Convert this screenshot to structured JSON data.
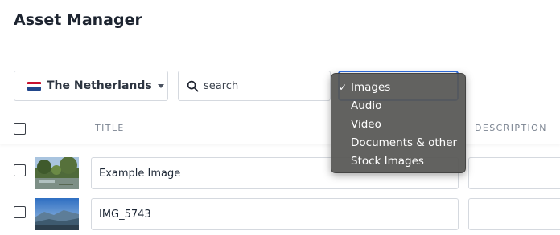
{
  "app": {
    "title": "Asset Manager"
  },
  "filters": {
    "country": {
      "label": "The Netherlands",
      "flag_colors": [
        "#c8102e",
        "#ffffff",
        "#21468b"
      ]
    },
    "search": {
      "placeholder": "search",
      "value": ""
    },
    "type_select": {
      "selected": "Images",
      "check_mark": "✓",
      "options": [
        "Images",
        "Audio",
        "Video",
        "Documents & other",
        "Stock Images"
      ]
    }
  },
  "table": {
    "columns": {
      "title": "TITLE",
      "description": "DESCRIPTION"
    },
    "rows": [
      {
        "title": "Example Image",
        "description": "",
        "thumbnail": "landscape-pond-thumbnail"
      },
      {
        "title": "IMG_5743",
        "description": "",
        "thumbnail": "mountain-valley-thumbnail"
      }
    ]
  },
  "colors": {
    "accent": "#2f6fe4",
    "dropdown_bg": "#585856"
  }
}
